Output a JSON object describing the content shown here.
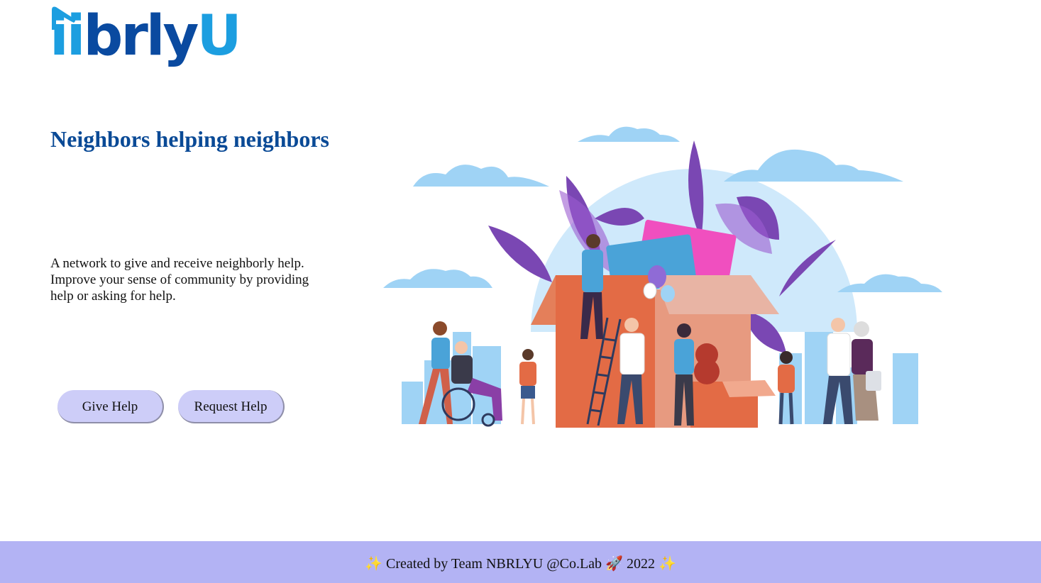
{
  "logo": {
    "text_a": "ii",
    "text_b": "brly",
    "text_c": "U",
    "colors": {
      "light": "#1c9ee0",
      "dark": "#0a4aa0"
    }
  },
  "hero": {
    "headline": "Neighbors helping neighbors",
    "description": "A network to give and receive neighborly help. Improve your sense of community by providing help or asking for help."
  },
  "actions": {
    "give_help": "Give Help",
    "request_help": "Request Help"
  },
  "illustration": {
    "icon": "community-illustration"
  },
  "footer": {
    "text": "✨ Created by Team NBRLYU @Co.Lab 🚀 2022 ✨"
  },
  "colors": {
    "headline": "#0a4a96",
    "button_bg": "#cdcdf8",
    "footer_bg": "#b3b3f4"
  }
}
